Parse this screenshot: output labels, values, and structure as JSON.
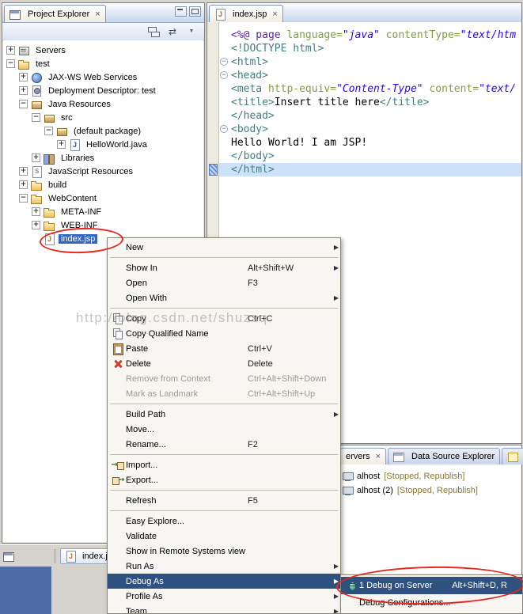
{
  "colors": {
    "selection": "#3166C4",
    "menu_highlight": "#2F5180",
    "annotation": "#E8281E",
    "server_state": "#8B7536"
  },
  "watermark": "http://blog.csdn.net/shuzsq",
  "left_panel": {
    "title": "Project Explorer",
    "tree": {
      "items": [
        {
          "label": "Servers",
          "level": 0,
          "expander": "plus",
          "icon": "servers"
        },
        {
          "label": "test",
          "level": 0,
          "expander": "minus",
          "icon": "project"
        },
        {
          "label": "JAX-WS Web Services",
          "level": 1,
          "expander": "plus",
          "icon": "globe"
        },
        {
          "label": "Deployment Descriptor: test",
          "level": 1,
          "expander": "plus",
          "icon": "descriptor"
        },
        {
          "label": "Java Resources",
          "level": 1,
          "expander": "minus",
          "icon": "package"
        },
        {
          "label": "src",
          "level": 2,
          "expander": "minus",
          "icon": "src"
        },
        {
          "label": "(default package)",
          "level": 3,
          "expander": "minus",
          "icon": "package"
        },
        {
          "label": "HelloWorld.java",
          "level": 4,
          "expander": "plus",
          "icon": "javafile"
        },
        {
          "label": "Libraries",
          "level": 2,
          "expander": "plus",
          "icon": "library"
        },
        {
          "label": "JavaScript Resources",
          "level": 1,
          "expander": "plus",
          "icon": "jsres"
        },
        {
          "label": "build",
          "level": 1,
          "expander": "plus",
          "icon": "folder"
        },
        {
          "label": "WebContent",
          "level": 1,
          "expander": "minus",
          "icon": "folder"
        },
        {
          "label": "META-INF",
          "level": 2,
          "expander": "plus",
          "icon": "folder"
        },
        {
          "label": "WEB-INF",
          "level": 2,
          "expander": "plus",
          "icon": "folder"
        },
        {
          "label": "index.jsp",
          "level": 2,
          "expander": "none",
          "icon": "jspfile",
          "selected": true
        }
      ]
    }
  },
  "editor": {
    "tab": "index.jsp",
    "lines": [
      {
        "segments": [
          {
            "t": "<%@ page ",
            "c": "d"
          },
          {
            "t": "language=",
            "c": "a"
          },
          {
            "t": "\"java\"",
            "c": "v"
          },
          {
            "t": " contentType=",
            "c": "a"
          },
          {
            "t": "\"text/htm",
            "c": "v"
          }
        ]
      },
      {
        "segments": [
          {
            "t": "<!DOCTYPE html>",
            "c": "t"
          }
        ]
      },
      {
        "fold": true,
        "segments": [
          {
            "t": "<html>",
            "c": "t"
          }
        ]
      },
      {
        "fold": true,
        "segments": [
          {
            "t": "<head>",
            "c": "t"
          }
        ]
      },
      {
        "segments": [
          {
            "t": "<meta ",
            "c": "t"
          },
          {
            "t": "http-equiv=",
            "c": "a"
          },
          {
            "t": "\"Content-Type\"",
            "c": "v"
          },
          {
            "t": " content=",
            "c": "a"
          },
          {
            "t": "\"text/",
            "c": "v"
          }
        ]
      },
      {
        "segments": [
          {
            "t": "<title>",
            "c": "t"
          },
          {
            "t": "Insert title here",
            "c": "x"
          },
          {
            "t": "</title>",
            "c": "t"
          }
        ]
      },
      {
        "segments": [
          {
            "t": "</head>",
            "c": "t"
          }
        ]
      },
      {
        "fold": true,
        "segments": [
          {
            "t": "<body>",
            "c": "t"
          }
        ]
      },
      {
        "segments": [
          {
            "t": "Hello World! I am JSP!",
            "c": "x"
          }
        ]
      },
      {
        "segments": [
          {
            "t": "</body>",
            "c": "t"
          }
        ]
      },
      {
        "highlighted": true,
        "segments": [
          {
            "t": "</html>",
            "c": "t"
          }
        ]
      }
    ]
  },
  "context_menu": {
    "items": [
      {
        "label": "New",
        "submenu": true
      },
      {
        "sep": true
      },
      {
        "label": "Show In",
        "shortcut": "Alt+Shift+W",
        "submenu": true
      },
      {
        "label": "Open",
        "shortcut": "F3"
      },
      {
        "label": "Open With",
        "submenu": true
      },
      {
        "sep": true
      },
      {
        "label": "Copy",
        "shortcut": "Ctrl+C",
        "icon": "copy"
      },
      {
        "label": "Copy Qualified Name",
        "icon": "copy-qualified"
      },
      {
        "label": "Paste",
        "shortcut": "Ctrl+V",
        "icon": "paste"
      },
      {
        "label": "Delete",
        "shortcut": "Delete",
        "icon": "delete"
      },
      {
        "label": "Remove from Context",
        "shortcut": "Ctrl+Alt+Shift+Down",
        "disabled": true
      },
      {
        "label": "Mark as Landmark",
        "shortcut": "Ctrl+Alt+Shift+Up",
        "disabled": true
      },
      {
        "sep": true
      },
      {
        "label": "Build Path",
        "submenu": true
      },
      {
        "label": "Move..."
      },
      {
        "label": "Rename...",
        "shortcut": "F2"
      },
      {
        "sep": true
      },
      {
        "label": "Import...",
        "icon": "import"
      },
      {
        "label": "Export...",
        "icon": "export"
      },
      {
        "sep": true
      },
      {
        "label": "Refresh",
        "shortcut": "F5"
      },
      {
        "sep": true
      },
      {
        "label": "Easy Explore..."
      },
      {
        "label": "Validate"
      },
      {
        "label": "Show in Remote Systems view"
      },
      {
        "label": "Run As",
        "submenu": true
      },
      {
        "label": "Debug As",
        "submenu": true,
        "highlighted": true
      },
      {
        "label": "Profile As",
        "submenu": true
      },
      {
        "label": "Team",
        "submenu": true
      }
    ]
  },
  "debug_submenu": {
    "items": [
      {
        "label": "1 Debug on Server",
        "shortcut": "Alt+Shift+D, R",
        "icon": "debug",
        "highlighted": true
      },
      {
        "label": "Debug Configurations..."
      }
    ]
  },
  "servers_view": {
    "tabs": [
      {
        "label": "ervers",
        "close": true,
        "selected": true
      },
      {
        "label": "Data Source Explorer",
        "icon": "data-source"
      },
      {
        "label": "S",
        "icon": "snippet"
      }
    ],
    "rows": [
      {
        "name": "alhost",
        "state": "[Stopped, Republish]"
      },
      {
        "name": "alhost (2)",
        "state": "[Stopped, Republish]"
      }
    ]
  },
  "bottom_bar": {
    "editor_chip": "index.js"
  }
}
